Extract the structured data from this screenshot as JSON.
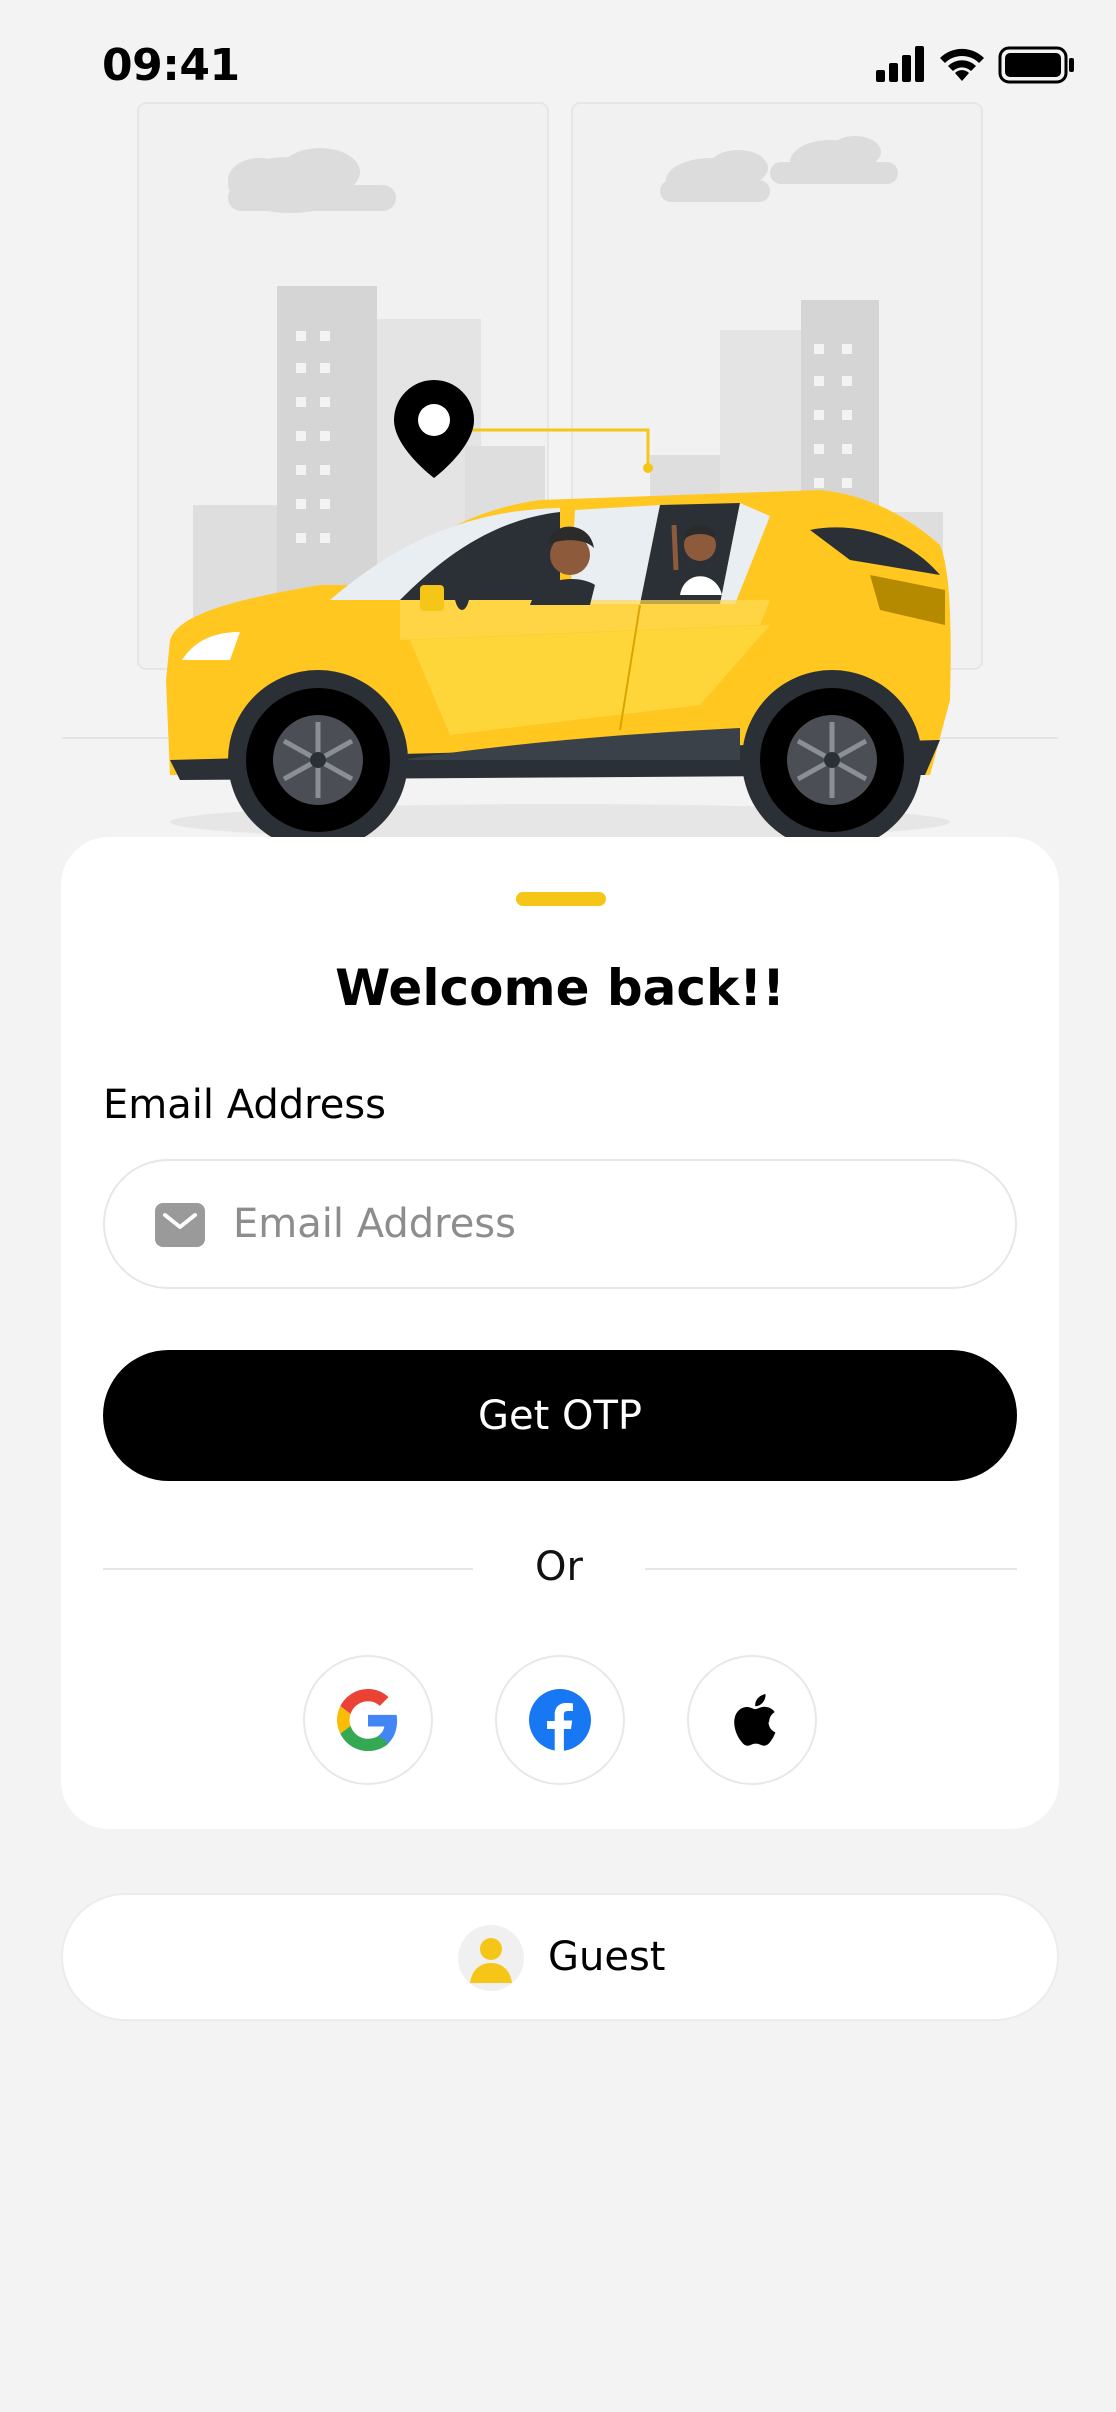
{
  "status_bar": {
    "time": "09:41",
    "icons": [
      "signal-icon",
      "wifi-icon",
      "battery-icon"
    ]
  },
  "illustration": {
    "description_icon": "taxi-car-illustration",
    "accent_color": "#f5c518"
  },
  "login_card": {
    "title": "Welcome back!!",
    "email_label": "Email Address",
    "email_placeholder": "Email Address",
    "email_value": "",
    "submit_label": "Get OTP",
    "divider_text": "Or",
    "social": [
      {
        "provider": "google",
        "icon": "google-icon"
      },
      {
        "provider": "facebook",
        "icon": "facebook-icon"
      },
      {
        "provider": "apple",
        "icon": "apple-icon"
      }
    ]
  },
  "guest": {
    "label": "Guest",
    "icon": "user-avatar-icon"
  },
  "colors": {
    "background": "#f3f3f3",
    "card": "#ffffff",
    "primary_button": "#000000",
    "accent": "#f5c518",
    "facebook": "#1877f2"
  }
}
